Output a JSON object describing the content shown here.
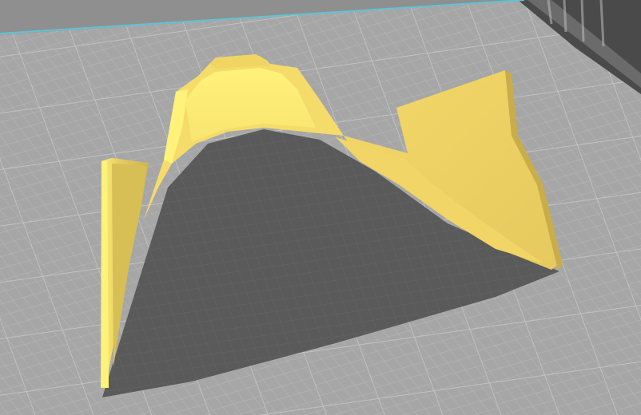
{
  "app": {
    "view": "3d-slicer-viewport"
  },
  "scene": {
    "object": "printed-model",
    "model_color": "#f5dc6a",
    "model_highlight": "#fff27a",
    "model_shade": "#c9ad4a",
    "plate_color": "#a7a7a7",
    "grid_minor_color": "#b3b3b3",
    "grid_major_color": "#c4c4c4",
    "background_color": "#8f8f8f",
    "volume_edge_color": "#5fc3d6",
    "shadow_color": "#585858"
  }
}
